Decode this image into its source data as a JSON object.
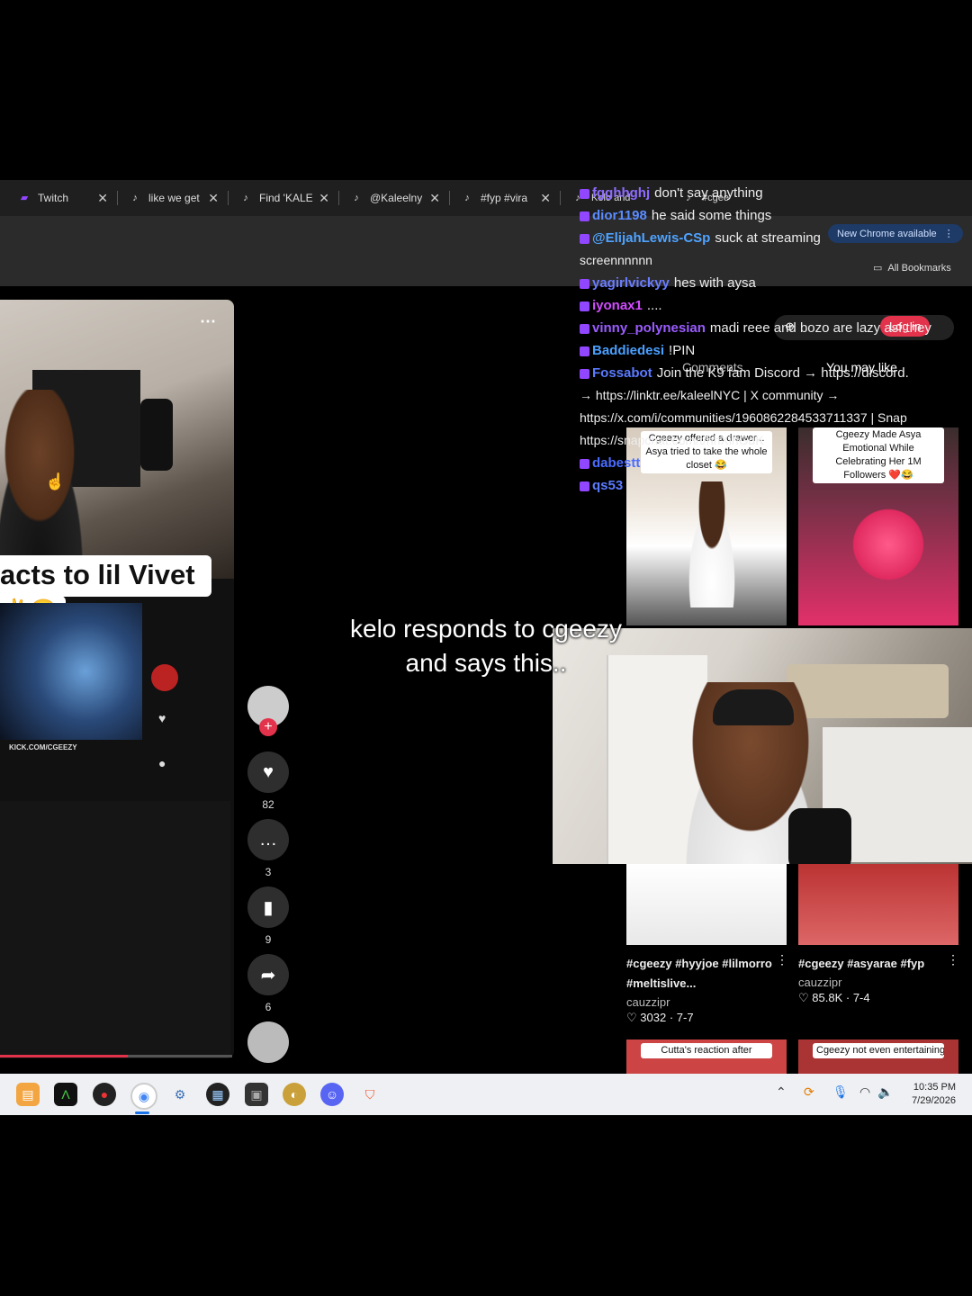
{
  "tabs": [
    {
      "label": "Twitch",
      "icon": "twitch-icon"
    },
    {
      "label": "like we get",
      "icon": "tiktok-icon"
    },
    {
      "label": "Find 'KALE",
      "icon": "tiktok-icon"
    },
    {
      "label": "@Kaleelny",
      "icon": "tiktok-icon"
    },
    {
      "label": "#fyp #vira",
      "icon": "tiktok-icon"
    },
    {
      "label": "Kelo and",
      "icon": "tiktok-icon"
    },
    {
      "label": "#cgee",
      "icon": "tiktok-icon"
    }
  ],
  "browser": {
    "update_label": "New Chrome available",
    "bookmarks_label": "All Bookmarks"
  },
  "video": {
    "caption": "acts to lil Vivet",
    "caption_emoji": "✌😂",
    "kick_watermark": "KICK.COM/CGEEZY",
    "likes": "82",
    "comments": "3",
    "saves": "9",
    "shares": "6"
  },
  "overlay": {
    "line1": "kelo responds to cgeezy",
    "line2": "and says this.."
  },
  "chat": [
    {
      "user": "fgghhghj",
      "color": "#8f6cff",
      "msg": "don't say anything"
    },
    {
      "user": "dior1198",
      "color": "#5b8cff",
      "msg": "he said some things"
    },
    {
      "user": "@ElijahLewis-CSp",
      "color": "#4fa3ff",
      "msg": "suck at streaming"
    },
    {
      "user": "",
      "color": "#e02b2b",
      "msg": "screennnnnn"
    },
    {
      "user": "yagirlvickyy",
      "color": "#6a7cff",
      "msg": "hes with aysa"
    },
    {
      "user": "iyonax1",
      "color": "#d24cff",
      "msg": "...."
    },
    {
      "user": "vinny_polynesian",
      "color": "#9b5cff",
      "msg": "madi reee and bozo are lazy asf they"
    },
    {
      "user": "Baddiedesi",
      "color": "#4aa0ff",
      "msg": "!PIN"
    },
    {
      "user": "Fossabot",
      "color": "#5b7bff",
      "msg": "Join the K9 fam Discord → https://discord."
    },
    {
      "user": "",
      "color": "#ffffff",
      "msg": "→ https://linktr.ee/kaleelNYC | X community →"
    },
    {
      "user": "",
      "color": "#ffffff",
      "msg": "https://x.com/i/communities/1960862284533711337 | Snap"
    },
    {
      "user": "",
      "color": "#ffffff",
      "msg": "https://snapchat.com/t/hhXihGdK"
    },
    {
      "user": "dabestt",
      "color": "#4a6cff",
      "msg": ""
    },
    {
      "user": "qs53",
      "color": "#5b7bff",
      "msg": ""
    }
  ],
  "tiktok_side": {
    "comments_tab": "Comments",
    "you_may_like": "You may like",
    "login_label": "Log in"
  },
  "grid": [
    {
      "caption": "Cgeezy offered a drawer... Asya tried to take the whole closet 😂",
      "title": "#cgeezy #hyyjoe #lilmorro #meltislive...",
      "author": "cauzzipr",
      "likes": "3032",
      "date": "7-7"
    },
    {
      "caption": "Cgeezy Made Asya Emotional While Celebrating Her 1M Followers ❤️😂",
      "title": "#cgeezy #asyarae #fyp",
      "author": "cauzzipr",
      "likes": "85.8K",
      "date": "7-4"
    },
    {
      "caption": "Cutta's reaction after",
      "title": "",
      "author": "",
      "likes": "",
      "date": ""
    },
    {
      "caption": "Cgeezy not even entertaining scams",
      "title": "",
      "author": "",
      "likes": "",
      "date": ""
    }
  ],
  "taskbar": {
    "time": "10:35 PM",
    "date": "7/29/2026"
  },
  "colors": {
    "accent_red": "#e3324b",
    "chrome_blue": "#1a73e8"
  }
}
